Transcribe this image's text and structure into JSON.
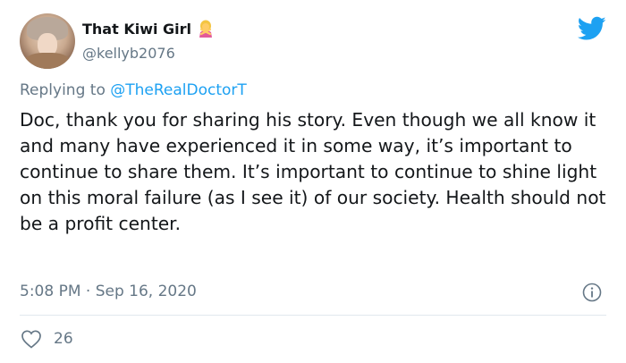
{
  "tweet": {
    "display_name": "That Kiwi Girl",
    "handle": "@kellyb2076",
    "name_emoji": "woman-gesturing-no-emoji",
    "replying_prefix": "Replying to ",
    "replying_to": "@TheRealDoctorT",
    "text": "Doc, thank you for sharing his story. Even though we all know it and many have experienced it in some way, it’s important to continue to share them. It’s important to continue to shine light on this moral failure (as I see it) of our society. Health should not be a profit center.",
    "timestamp": "5:08 PM · Sep 16, 2020",
    "like_count": "26"
  },
  "icons": {
    "brand": "twitter-bird-icon",
    "info": "info-icon",
    "like": "heart-outline-icon"
  },
  "colors": {
    "brand_blue": "#1da1f2",
    "secondary_text": "#657786",
    "primary_text": "#14171a",
    "divider": "#e1e8ed"
  }
}
